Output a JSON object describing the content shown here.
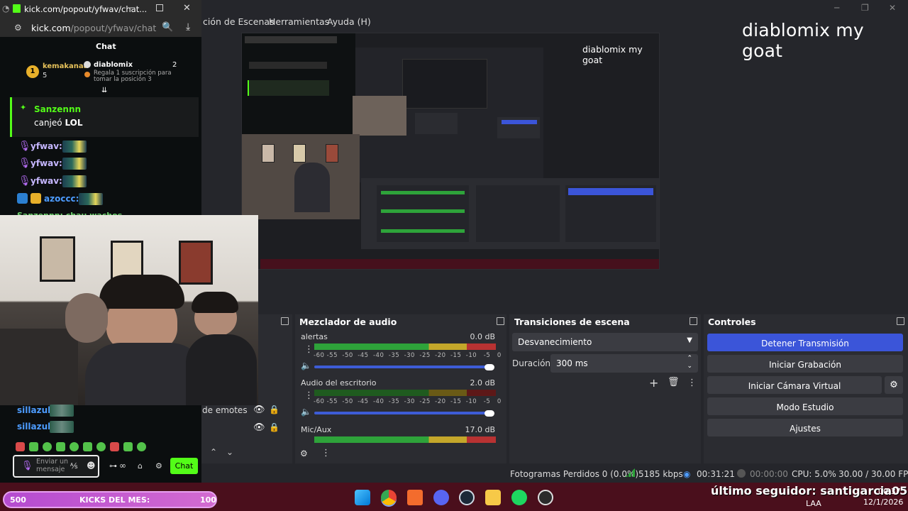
{
  "obs": {
    "menu": [
      "ción de Escenas",
      "Herramientas",
      "Ayuda (H)"
    ],
    "overlay_text": "diablomix my goat",
    "preview_text": "diablomix my goat",
    "docks": {
      "mixer_title": "Mezclador de audio",
      "transitions_title": "Transiciones de escena",
      "controls_title": "Controles"
    },
    "mixer": {
      "channels": [
        {
          "name": "alertas",
          "db": "0.0 dB"
        },
        {
          "name": "Audio del escritorio",
          "db": "2.0 dB"
        },
        {
          "name": "Mic/Aux",
          "db": "17.0 dB"
        }
      ],
      "ticks": [
        "-60",
        "-55",
        "-50",
        "-45",
        "-40",
        "-35",
        "-30",
        "-25",
        "-20",
        "-15",
        "-10",
        "-5",
        "0"
      ]
    },
    "transitions": {
      "selected": "Desvanecimiento",
      "duration_label": "Duración",
      "duration_value": "300 ms"
    },
    "controls": {
      "stop_stream": "Detener Transmisión",
      "start_recording": "Iniciar Grabación",
      "start_virtual_cam": "Iniciar Cámara Virtual",
      "studio_mode": "Modo Estudio",
      "settings": "Ajustes"
    },
    "sources_partial": "de emotes",
    "status": {
      "dropped_frames": "Fotogramas Perdidos 0 (0.0%)",
      "bitrate": "5185 kbps",
      "stream_time": "00:31:21",
      "rec_time": "00:00:00",
      "cpu": "CPU: 5.0%",
      "fps": "30.00 / 30.00 FPS"
    }
  },
  "kick": {
    "tab_title": "kick.com/popout/yfwav/chat...",
    "url_host": "kick.com",
    "url_path": "/popout/yfwav/chat",
    "chat_header": "Chat",
    "leaderboard": [
      {
        "rank": "1",
        "name": "kemakanaa",
        "count": "5"
      },
      {
        "rank": "2",
        "name": "diablomix",
        "count": "2",
        "note": "Regala 1 suscripción para tomar la posición 3"
      }
    ],
    "highlight": {
      "user": "Sanzennn",
      "text_prefix": "canjeó ",
      "text_bold": "LOL"
    },
    "messages": [
      {
        "user": "yfwav:",
        "color": "#c6b7ff"
      },
      {
        "user": "yfwav:",
        "color": "#c6b7ff"
      },
      {
        "user": "yfwav:",
        "color": "#c6b7ff"
      },
      {
        "user": "azoccc:",
        "color": "#4d9cff"
      }
    ],
    "partial_message": "Sanzennn: chau wachos",
    "lower_messages": [
      {
        "user": "sillazul:",
        "color": "#4d9cff"
      },
      {
        "user": "sillazul:",
        "color": "#4d9cff"
      }
    ],
    "input_placeholder": "Enviar un mensaje",
    "send_button": "Chat"
  },
  "stream_overlay": {
    "kicks_left": "500",
    "kicks_label": "KICKS DEL MES:",
    "kicks_right": "100",
    "last_follower": "último seguidor: santigarcia05"
  },
  "tray": {
    "lang": "LAA",
    "time": "00:37",
    "date": "12/1/2026"
  }
}
